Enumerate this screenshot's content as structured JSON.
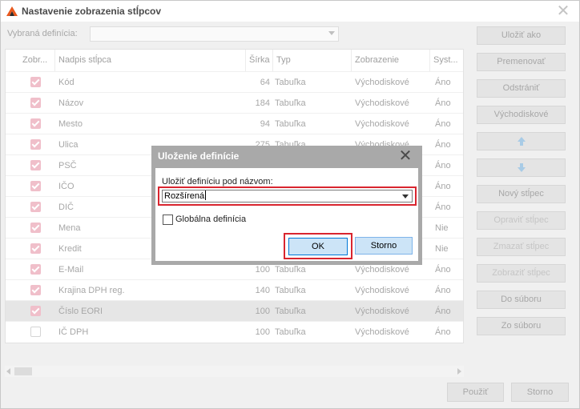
{
  "window": {
    "title": "Nastavenie zobrazenia stĺpcov",
    "close_glyph": "✕"
  },
  "definition": {
    "label": "Vybraná definícia:",
    "value": ""
  },
  "grid": {
    "headers": [
      "Zobr...",
      "Nadpis stĺpca",
      "Šírka",
      "Typ",
      "Zobrazenie",
      "Syst..."
    ],
    "rows": [
      {
        "checked": true,
        "name": "Kód",
        "width": "64",
        "type": "Tabuľka",
        "display": "Východiskové",
        "system": "Áno"
      },
      {
        "checked": true,
        "name": "Názov",
        "width": "184",
        "type": "Tabuľka",
        "display": "Východiskové",
        "system": "Áno"
      },
      {
        "checked": true,
        "name": "Mesto",
        "width": "94",
        "type": "Tabuľka",
        "display": "Východiskové",
        "system": "Áno"
      },
      {
        "checked": true,
        "name": "Ulica",
        "width": "275",
        "type": "Tabuľka",
        "display": "Východiskové",
        "system": "Áno"
      },
      {
        "checked": true,
        "name": "PSČ",
        "width": "",
        "type": "",
        "display": "",
        "system": "Áno"
      },
      {
        "checked": true,
        "name": "IČO",
        "width": "",
        "type": "",
        "display": "",
        "system": "Áno"
      },
      {
        "checked": true,
        "name": "DIČ",
        "width": "",
        "type": "",
        "display": "",
        "system": "Áno"
      },
      {
        "checked": true,
        "name": "Mena",
        "width": "",
        "type": "",
        "display": "",
        "system": "Nie"
      },
      {
        "checked": true,
        "name": "Kredit",
        "width": "",
        "type": "",
        "display": "",
        "system": "Nie"
      },
      {
        "checked": true,
        "name": "E-Mail",
        "width": "100",
        "type": "Tabuľka",
        "display": "Východiskové",
        "system": "Áno"
      },
      {
        "checked": true,
        "name": "Krajina DPH reg.",
        "width": "140",
        "type": "Tabuľka",
        "display": "Východiskové",
        "system": "Áno"
      },
      {
        "checked": true,
        "name": "Číslo EORI",
        "width": "100",
        "type": "Tabuľka",
        "display": "Východiskové",
        "system": "Áno",
        "selected": true
      },
      {
        "checked": false,
        "name": "IČ DPH",
        "width": "100",
        "type": "Tabuľka",
        "display": "Východiskové",
        "system": "Áno"
      }
    ]
  },
  "side_buttons": {
    "save_as": "Uložiť ako",
    "rename": "Premenovať",
    "remove": "Odstrániť",
    "default": "Východiskové",
    "new_column": "Nový stĺpec",
    "edit_column": "Opraviť stĺpec",
    "delete_column": "Zmazať stĺpec",
    "show_column": "Zobraziť stĺpec",
    "to_file": "Do súboru",
    "from_file": "Zo súboru"
  },
  "footer": {
    "apply": "Použiť",
    "cancel": "Storno"
  },
  "dialog": {
    "title": "Uloženie definície",
    "close_glyph": "✕",
    "name_label": "Uložiť definíciu pod názvom:",
    "name_value": "Rozšírená",
    "global_label": "Globálna definícia",
    "global_checked": false,
    "ok": "OK",
    "cancel": "Storno"
  },
  "colors": {
    "highlight": "#d9252f",
    "ok_border": "#0078d7",
    "checkbox_dimmed": "#f0bfca"
  }
}
